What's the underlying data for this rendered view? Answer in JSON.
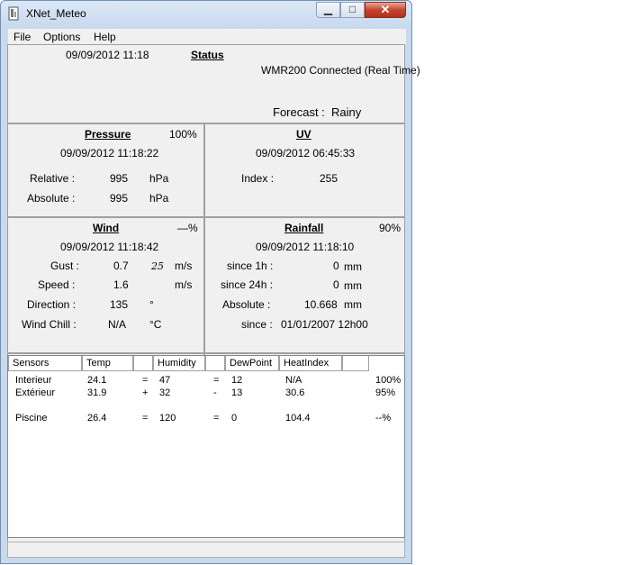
{
  "window": {
    "title": "XNet_Meteo"
  },
  "menu": {
    "file": "File",
    "options": "Options",
    "help": "Help"
  },
  "status": {
    "datetime": "09/09/2012 11:18",
    "header": "Status",
    "connection": "WMR200 Connected (Real Time)",
    "forecast_label": "Forecast :",
    "forecast_value": "Rainy"
  },
  "pressure": {
    "header": "Pressure",
    "battery": "100%",
    "datetime": "09/09/2012 11:18:22",
    "relative_label": "Relative :",
    "relative_value": "995",
    "relative_unit": "hPa",
    "absolute_label": "Absolute :",
    "absolute_value": "995",
    "absolute_unit": "hPa"
  },
  "uv": {
    "header": "UV",
    "datetime": "09/09/2012 06:45:33",
    "index_label": "Index :",
    "index_value": "255"
  },
  "wind": {
    "header": "Wind",
    "battery": "—%",
    "datetime": "09/09/2012 11:18:42",
    "gust_label": "Gust :",
    "gust_value": "0.7",
    "gust_extra": "25",
    "gust_unit": "m/s",
    "speed_label": "Speed :",
    "speed_value": "1.6",
    "speed_unit": "m/s",
    "direction_label": "Direction :",
    "direction_value": "135",
    "direction_unit": "°",
    "chill_label": "Wind Chill :",
    "chill_value": "N/A",
    "chill_unit": "°C"
  },
  "rainfall": {
    "header": "Rainfall",
    "battery": "90%",
    "datetime": "09/09/2012 11:18:10",
    "since1h_label": "since 1h :",
    "since1h_value": "0",
    "since1h_unit": "mm",
    "since24h_label": "since 24h :",
    "since24h_value": "0",
    "since24h_unit": "mm",
    "absolute_label": "Absolute :",
    "absolute_value": "10.668",
    "absolute_unit": "mm",
    "since_label": "since :",
    "since_value": "01/01/2007 12h00"
  },
  "sensors": {
    "columns": [
      "Sensors",
      "Temp",
      "",
      "Humidity",
      "",
      "DewPoint",
      "HeatIndex",
      ""
    ],
    "rows": [
      [
        "Interieur",
        "24.1",
        "=",
        "47",
        "=",
        "12",
        "N/A",
        "100%"
      ],
      [
        "Extérieur",
        "31.9",
        "+",
        "32",
        "-",
        "13",
        "30.6",
        "95%"
      ],
      [
        "Piscine",
        "26.4",
        "=",
        "120",
        "=",
        "0",
        "104.4",
        "--%"
      ]
    ]
  }
}
